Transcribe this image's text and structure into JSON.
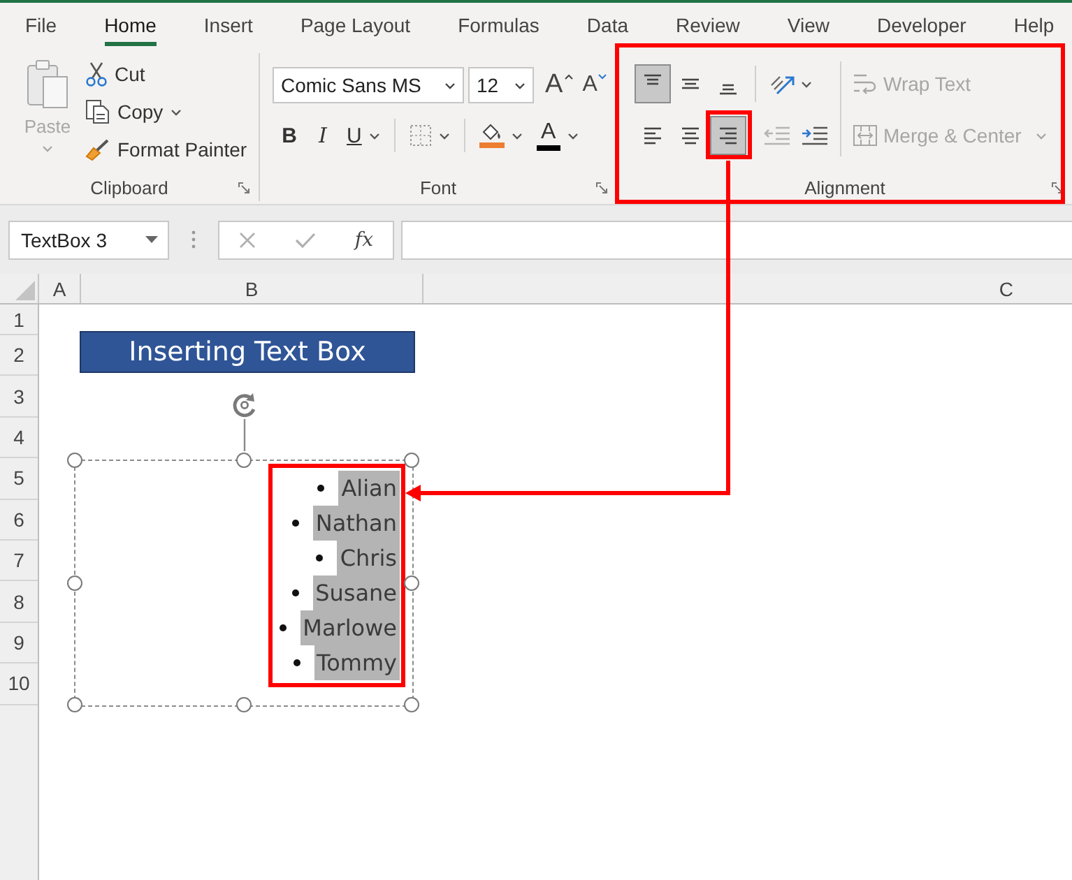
{
  "tabs": [
    {
      "label": "File",
      "selected": false
    },
    {
      "label": "Home",
      "selected": true
    },
    {
      "label": "Insert",
      "selected": false
    },
    {
      "label": "Page Layout",
      "selected": false
    },
    {
      "label": "Formulas",
      "selected": false
    },
    {
      "label": "Data",
      "selected": false
    },
    {
      "label": "Review",
      "selected": false
    },
    {
      "label": "View",
      "selected": false
    },
    {
      "label": "Developer",
      "selected": false
    },
    {
      "label": "Help",
      "selected": false
    }
  ],
  "ribbon": {
    "clipboard": {
      "label": "Clipboard",
      "paste": {
        "label": "Paste",
        "disabled": true
      },
      "cut": "Cut",
      "copy": "Copy",
      "format_painter": "Format Painter"
    },
    "font": {
      "label": "Font",
      "font_name": "Comic Sans MS",
      "font_size": "12",
      "grow_font": "A",
      "shrink_font": "A",
      "bold": "B",
      "italic": "I",
      "underline": "U",
      "font_color": "A"
    },
    "alignment": {
      "label": "Alignment",
      "highlighted": true,
      "vertical": [
        {
          "kind": "top",
          "selected": true
        },
        {
          "kind": "middle",
          "selected": false
        },
        {
          "kind": "bottom",
          "selected": false
        }
      ],
      "wrap_text": {
        "label": "Wrap Text",
        "disabled": true
      },
      "horizontal": [
        {
          "kind": "left",
          "selected": false,
          "highlighted": false
        },
        {
          "kind": "center",
          "selected": false,
          "highlighted": false
        },
        {
          "kind": "right",
          "selected": true,
          "highlighted": true
        }
      ],
      "indent": [
        {
          "kind": "decrease",
          "disabled": true
        },
        {
          "kind": "increase",
          "disabled": false
        }
      ],
      "merge_center": {
        "label": "Merge & Center",
        "disabled": true
      }
    }
  },
  "formula_bar": {
    "name_box": "TextBox 3",
    "function_label": "fx"
  },
  "sheet": {
    "columns": [
      "A",
      "B",
      "C"
    ],
    "rows": [
      "1",
      "2",
      "3",
      "4",
      "5",
      "6",
      "7",
      "8",
      "9",
      "10"
    ],
    "title": "Inserting Text Box",
    "text_box": {
      "highlighted": true,
      "items": [
        {
          "text": "Alian",
          "selected": true
        },
        {
          "text": "Nathan",
          "selected": true
        },
        {
          "text": "Chris",
          "selected": true
        },
        {
          "text": "Susane",
          "selected": true
        },
        {
          "text": "Marlowe",
          "selected": true
        },
        {
          "text": "Tommy",
          "selected": true
        }
      ]
    }
  }
}
